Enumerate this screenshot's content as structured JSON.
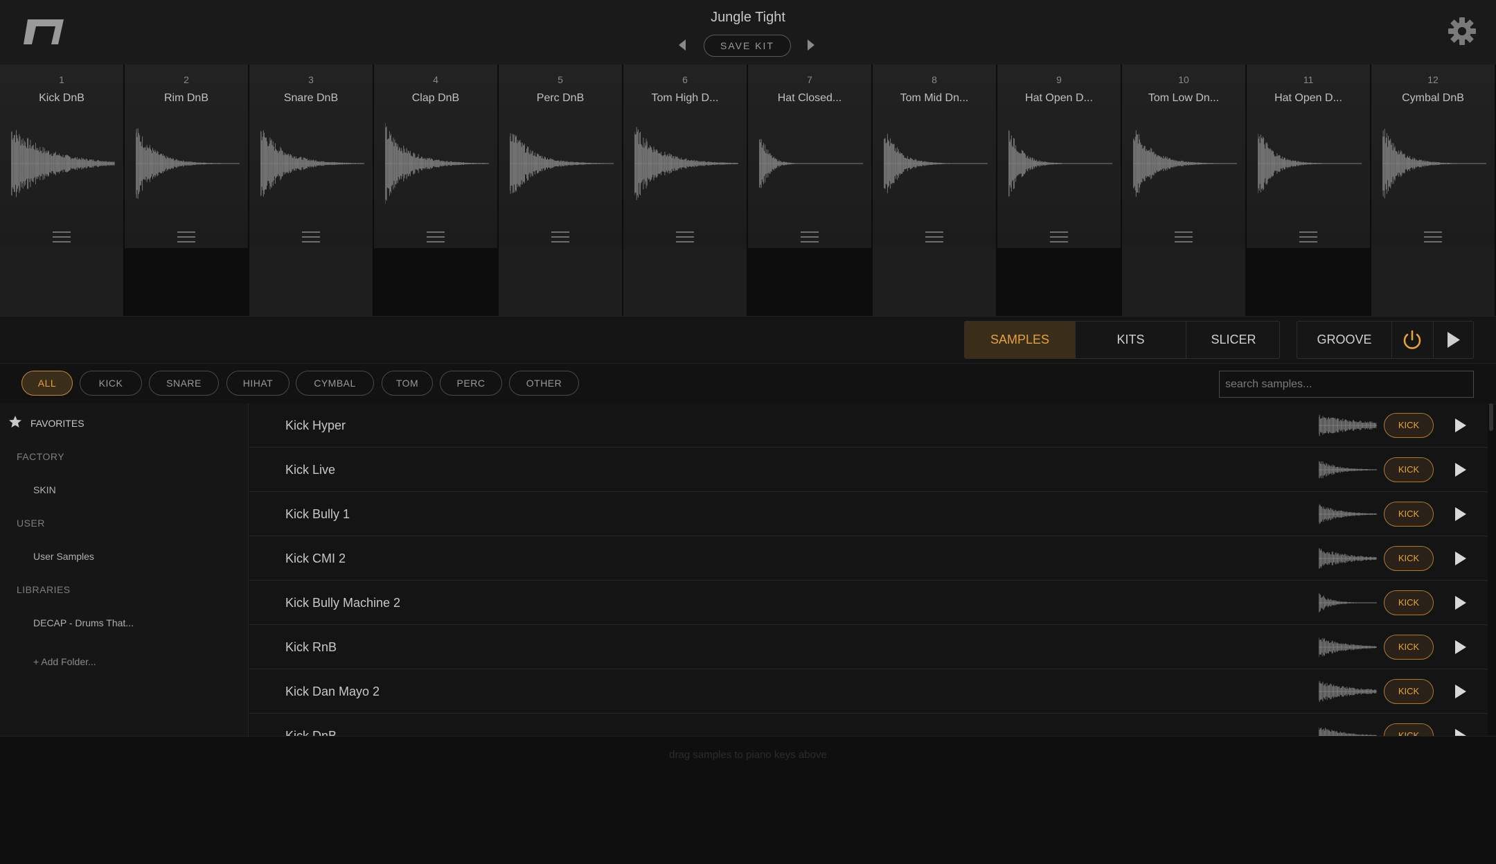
{
  "header": {
    "kit_name": "Jungle Tight",
    "save_kit_label": "SAVE KIT"
  },
  "pads": [
    {
      "num": "1",
      "name": "Kick DnB"
    },
    {
      "num": "2",
      "name": "Rim DnB"
    },
    {
      "num": "3",
      "name": "Snare DnB"
    },
    {
      "num": "4",
      "name": "Clap DnB"
    },
    {
      "num": "5",
      "name": "Perc DnB"
    },
    {
      "num": "6",
      "name": "Tom High D..."
    },
    {
      "num": "7",
      "name": "Hat Closed..."
    },
    {
      "num": "8",
      "name": "Tom Mid Dn..."
    },
    {
      "num": "9",
      "name": "Hat Open D..."
    },
    {
      "num": "10",
      "name": "Tom Low Dn..."
    },
    {
      "num": "11",
      "name": "Hat Open D..."
    },
    {
      "num": "12",
      "name": "Cymbal DnB"
    }
  ],
  "tabs": {
    "samples": "SAMPLES",
    "kits": "KITS",
    "slicer": "SLICER",
    "groove": "GROOVE",
    "active": "SAMPLES"
  },
  "filters": {
    "all": "ALL",
    "kick": "KICK",
    "snare": "SNARE",
    "hihat": "HIHAT",
    "cymbal": "CYMBAL",
    "tom": "TOM",
    "perc": "PERC",
    "other": "OTHER",
    "active": "ALL"
  },
  "search": {
    "placeholder": "search samples..."
  },
  "sidebar": {
    "favorites": "FAVORITES",
    "factory_heading": "FACTORY",
    "factory_item": "SKIN",
    "user_heading": "USER",
    "user_item": "User Samples",
    "libraries_heading": "LIBRARIES",
    "libraries_item": "DECAP - Drums That...",
    "add_folder": "+ Add Folder..."
  },
  "samples": [
    {
      "name": "Kick Hyper",
      "tag": "KICK"
    },
    {
      "name": "Kick Live",
      "tag": "KICK"
    },
    {
      "name": "Kick Bully 1",
      "tag": "KICK"
    },
    {
      "name": "Kick CMI 2",
      "tag": "KICK"
    },
    {
      "name": "Kick Bully Machine 2",
      "tag": "KICK"
    },
    {
      "name": "Kick RnB",
      "tag": "KICK"
    },
    {
      "name": "Kick Dan Mayo 2",
      "tag": "KICK"
    },
    {
      "name": "Kick DnB",
      "tag": "KICK"
    }
  ],
  "footer": {
    "hint": "drag samples to piano keys above"
  },
  "colors": {
    "accent": "#e6a23c",
    "background": "#0f0f0f",
    "panel": "#1d1d1d",
    "waveform": "#7d7d7d"
  }
}
